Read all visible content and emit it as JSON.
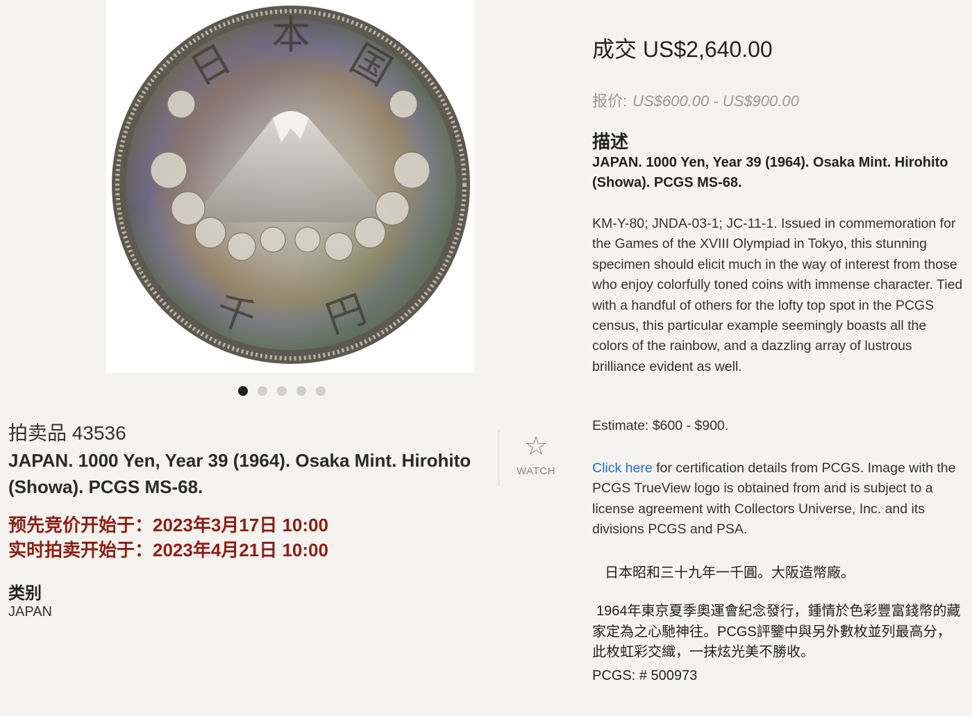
{
  "gallery": {
    "image_label": "",
    "dots": [
      true,
      false,
      false,
      false,
      false
    ]
  },
  "lot": {
    "number_label": "拍卖品 43536",
    "title": "JAPAN. 1000 Yen, Year 39 (1964). Osaka Mint. Hirohito (Showa). PCGS MS-68.",
    "prebid_start": "预先竞价开始于：2023年3月17日 10:00",
    "live_start": "实时拍卖开始于：2023年4月21日 10:00",
    "category_label": "类别",
    "category_value": "JAPAN"
  },
  "watch": {
    "icon": "star-outline-icon",
    "label": "WATCH"
  },
  "pricing": {
    "sold": "成交 US$2,640.00",
    "estimate_label": "报价:",
    "estimate_range": "US$600.00 - US$900.00"
  },
  "description": {
    "heading": "描述",
    "title": "JAPAN. 1000 Yen, Year 39 (1964). Osaka Mint. Hirohito (Showa). PCGS MS-68.",
    "body": "KM-Y-80; JNDA-03-1; JC-11-1. Issued in commemoration for the Games of the XVIII Olympiad in Tokyo, this stunning specimen should elicit much in the way of interest from those who enjoy colorfully toned coins with immense character. Tied with a handful of others for the lofty top spot in the PCGS census, this particular example seemingly boasts all the colors of the rainbow, and a dazzling array of lustrous brilliance evident as well.",
    "estimate": "Estimate: $600 - $900.",
    "cert_link": "Click here",
    "cert_text": " for certification details from PCGS. Image with the PCGS TrueView logo is obtained from and is subject to a license agreement with Collectors Universe, Inc. and its divisions PCGS and PSA.",
    "cn_title": "日本昭和三十九年一千圓。大阪造幣廠。",
    "cn_body": "1964年東京夏季奧運會紀念發行，鍾情於色彩豐富錢幣的藏家定為之心馳神往。PCGS評鑒中與另外數枚並列最高分，此枚虹彩交織，一抹炫光美不勝收。",
    "pcgs": "PCGS: # 500973"
  },
  "colors": {
    "accent_red": "#8b1f15",
    "link_blue": "#1a6fd6",
    "background": "#f4f3ef"
  }
}
